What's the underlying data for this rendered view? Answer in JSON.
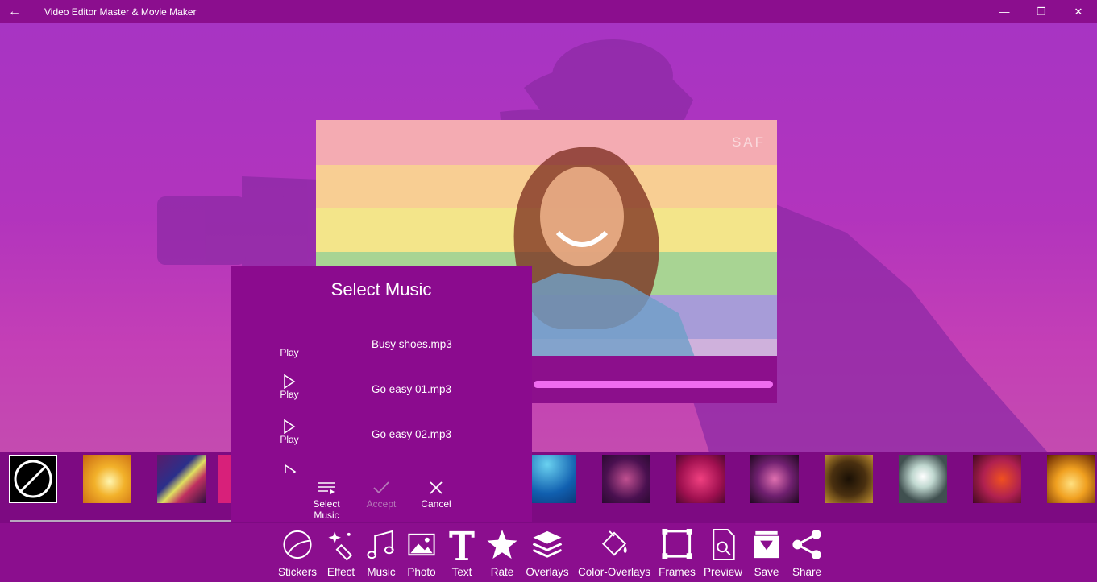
{
  "window": {
    "title": "Video Editor Master & Movie Maker",
    "back_icon": "←",
    "minimize_icon": "—",
    "restore_icon": "❐",
    "close_icon": "✕"
  },
  "preview": {
    "watermark": "SAF",
    "progress": 1.0
  },
  "dialog": {
    "title": "Select Music",
    "tracks": [
      {
        "play_label": "Play",
        "name": "Busy shoes.mp3"
      },
      {
        "play_label": "Play",
        "name": "Go easy 01.mp3"
      },
      {
        "play_label": "Play",
        "name": "Go easy 02.mp3"
      }
    ],
    "buttons": {
      "select": "Select Music",
      "accept": "Accept",
      "cancel": "Cancel"
    }
  },
  "toolbar": {
    "items": [
      {
        "label": "Stickers",
        "icon": "sticker-icon"
      },
      {
        "label": "Effect",
        "icon": "magic-wand-icon"
      },
      {
        "label": "Music",
        "icon": "music-note-icon"
      },
      {
        "label": "Photo",
        "icon": "photo-icon"
      },
      {
        "label": "Text",
        "icon": "text-icon"
      },
      {
        "label": "Rate",
        "icon": "star-icon"
      },
      {
        "label": "Overlays",
        "icon": "layers-icon"
      },
      {
        "label": "Color-Overlays",
        "icon": "paint-bucket-icon"
      },
      {
        "label": "Frames",
        "icon": "frame-icon"
      },
      {
        "label": "Preview",
        "icon": "document-search-icon"
      },
      {
        "label": "Save",
        "icon": "save-icon"
      },
      {
        "label": "Share",
        "icon": "share-icon"
      }
    ]
  },
  "colors": {
    "title_bar": "#8b0e8e",
    "background": "#a734c3",
    "dialog": "#8b0b8e",
    "progress": "#f06bf0"
  }
}
